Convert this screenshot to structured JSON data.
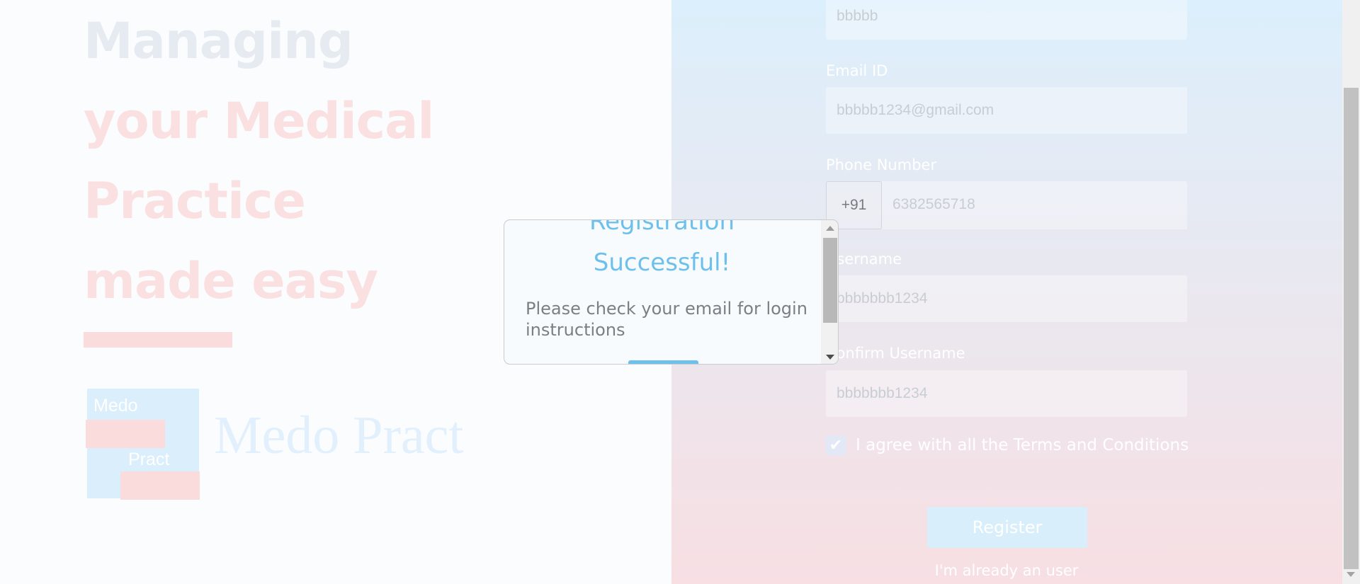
{
  "hero": {
    "line1": "Managing",
    "line2": "your Medical",
    "line3": "Practice",
    "line4": "made easy"
  },
  "logo": {
    "top_word": "Medo",
    "bottom_word": "Pract",
    "wordmark": "Medo Pract"
  },
  "form": {
    "name_value": "bbbbb",
    "email_label": "Email ID",
    "email_value": "bbbbb1234@gmail.com",
    "phone_label": "Phone Number",
    "phone_prefix": "+91",
    "phone_value": "6382565718",
    "username_label": "Username",
    "username_value": "bbbbbbb1234",
    "confirm_username_label": "Confirm Username",
    "confirm_username_value": "bbbbbbb1234",
    "terms_label": "I agree with all the Terms and Conditions",
    "terms_checked": true,
    "register_label": "Register",
    "login_link": "I'm already an user"
  },
  "modal": {
    "title_line1": "Registration",
    "title_line2": "Successful!",
    "message": "Please check your email for login instructions"
  },
  "colors": {
    "accent": "#6ec0ec",
    "hero_blue": "#e6ebf2",
    "hero_pink": "#fbe0e1",
    "panel_top": "#dceffc",
    "panel_bottom": "#f7dfe3"
  }
}
